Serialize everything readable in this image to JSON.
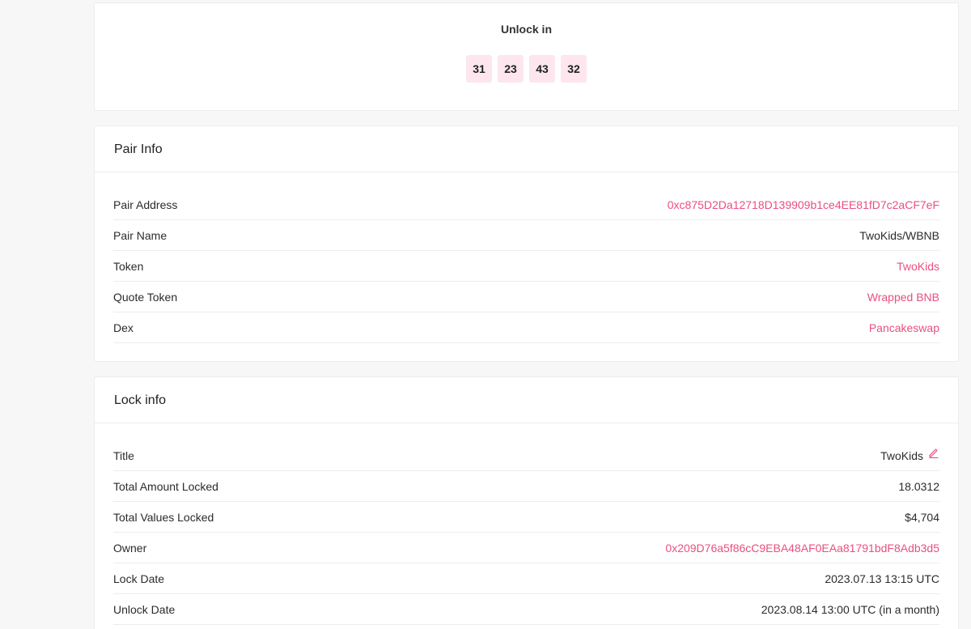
{
  "countdown": {
    "label": "Unlock in",
    "values": [
      "31",
      "23",
      "43",
      "32"
    ]
  },
  "pair_info": {
    "title": "Pair Info",
    "rows": [
      {
        "label": "Pair Address",
        "value": "0xc875D2Da12718D139909b1ce4EE81fD7c2aCF7eF"
      },
      {
        "label": "Pair Name",
        "value": "TwoKids/WBNB"
      },
      {
        "label": "Token",
        "value": "TwoKids"
      },
      {
        "label": "Quote Token",
        "value": "Wrapped BNB"
      },
      {
        "label": "Dex",
        "value": "Pancakeswap"
      }
    ]
  },
  "lock_info": {
    "title": "Lock info",
    "rows": [
      {
        "label": "Title",
        "value": "TwoKids"
      },
      {
        "label": "Total Amount Locked",
        "value": "18.0312"
      },
      {
        "label": "Total Values Locked",
        "value": "$4,704"
      },
      {
        "label": "Owner",
        "value": "0x209D76a5f86cC9EBA48AF0EAa81791bdF8Adb3d5"
      },
      {
        "label": "Lock Date",
        "value": "2023.07.13 13:15 UTC"
      },
      {
        "label": "Unlock Date",
        "value": "2023.08.14 13:00 UTC (in a month)"
      }
    ]
  },
  "colors": {
    "accent": "#e8507e",
    "countdown_bg": "#fde6ee"
  },
  "icons": {
    "edit": "pencil-icon"
  }
}
